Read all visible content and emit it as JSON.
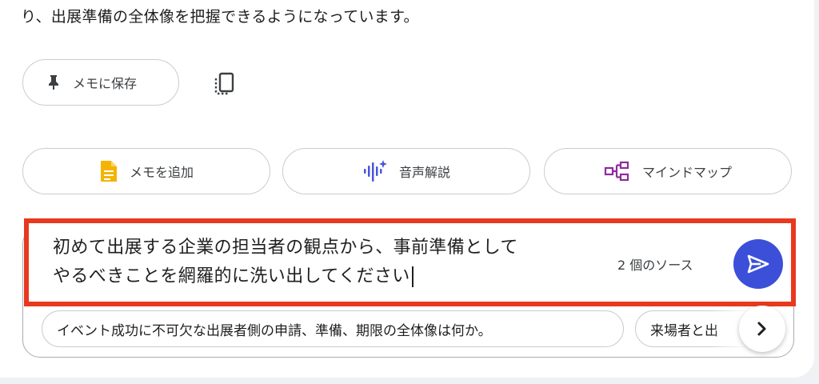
{
  "answer": {
    "tail_text": "り、出展準備の全体像を把握できるようになっています。"
  },
  "actions": {
    "save_note": {
      "label": "メモに保存",
      "icon": "pin-icon"
    },
    "copy": {
      "icon": "copy-icon"
    },
    "add_note": {
      "label": "メモを追加",
      "icon": "note-icon",
      "color": "#f4b400"
    },
    "audio_overview": {
      "label": "音声解説",
      "icon": "audio-waveform-icon",
      "color": "#4a55e0"
    },
    "mind_map": {
      "label": "マインドマップ",
      "icon": "mind-map-icon",
      "color": "#8e2c9c"
    }
  },
  "chat": {
    "query_line1": "初めて出展する企業の担当者の観点から、事前準備として",
    "query_line2": "やるべきことを網羅的に洗い出してください",
    "source_count": "2 個のソース",
    "send_icon": "send-icon",
    "send_color": "#3b4fd9",
    "highlight_color": "#e8391f"
  },
  "suggestions": {
    "items": [
      "イベント成功に不可欠な出展者側の申請、準備、期限の全体像は何か。",
      "来場者と出"
    ],
    "next_icon": "chevron-right-icon"
  }
}
